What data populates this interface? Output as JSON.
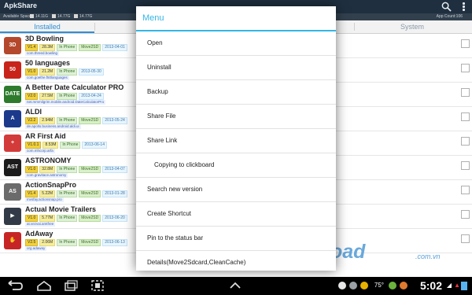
{
  "app": {
    "title": "ApkShare"
  },
  "store": {
    "label": "Available Space",
    "stats": [
      "14.11G",
      "14.77G",
      "14.77G"
    ],
    "count": "App Count:106"
  },
  "tabs": [
    {
      "label": "Installed"
    },
    {
      "label": ""
    },
    {
      "label": "System"
    }
  ],
  "apps": [
    {
      "name": "3D Bowling",
      "version": "V1.4",
      "size": "28.3M",
      "location": "In Phone",
      "move": "Move2SD",
      "date": "2013-04-01",
      "pkg": "com.threed.bowling",
      "icon_color": "#b4482c",
      "icon_text": "3D"
    },
    {
      "name": "50 languages",
      "version": "V1.0",
      "size": "21.2M",
      "location": "In Phone",
      "move": "",
      "date": "2013-05-30",
      "pkg": "com.goethe.f50languages",
      "icon_color": "#c8241a",
      "icon_text": "50"
    },
    {
      "name": "A Better Date Calculator PRO",
      "version": "V2.0",
      "size": "27.5M",
      "location": "In Phone",
      "move": "",
      "date": "2013-04-24",
      "pkg": "net.mmmilgrim.mobile.android.DateCalculatorPro",
      "icon_color": "#2e7b2d",
      "icon_text": "DATE"
    },
    {
      "name": "ALDI",
      "version": "V2.2",
      "size": "2.94M",
      "location": "In Phone",
      "move": "Move2SD",
      "date": "2013-05-24",
      "pkg": "de.apollo.business.android.aldi.ui",
      "icon_color": "#1b3a8c",
      "icon_text": "A"
    },
    {
      "name": "AR First Aid",
      "version": "V1.0.1",
      "size": "8.53M",
      "location": "In Phone",
      "move": "",
      "date": "2013-06-14",
      "pkg": "com.mhcorp.arfa",
      "icon_color": "#d33a3a",
      "icon_text": "+"
    },
    {
      "name": "ASTRONOMY",
      "version": "V1.0",
      "size": "32.8M",
      "location": "In Phone",
      "move": "Move2SD",
      "date": "2013-04-07",
      "pkg": "com.gravitace.astronomy",
      "icon_color": "#1c1c1c",
      "icon_text": "AST"
    },
    {
      "name": "ActionSnapPro",
      "version": "V1.4",
      "size": "5.22M",
      "location": "In Phone",
      "move": "Move2SD",
      "date": "2013-01-28",
      "pkg": "mvsfay.actionsnap.pro",
      "icon_color": "#6b6b6b",
      "icon_text": "AS"
    },
    {
      "name": "Actual Movie Trailers",
      "version": "V1.0",
      "size": "5.77M",
      "location": "In Phone",
      "move": "Move2SD",
      "date": "2013-06-20",
      "pkg": "at.vezvai.amtfree",
      "icon_color": "#333a47",
      "icon_text": "▶"
    },
    {
      "name": "AdAway",
      "version": "V2.5",
      "size": "2.06M",
      "location": "In Phone",
      "move": "Move2SD",
      "date": "2013-06-13",
      "pkg": "org.adaway",
      "icon_color": "#c72525",
      "icon_text": "✋"
    }
  ],
  "dialog": {
    "title": "Menu",
    "items": [
      {
        "label": "Open",
        "indent": false
      },
      {
        "label": "Uninstall",
        "indent": false
      },
      {
        "label": "Backup",
        "indent": false
      },
      {
        "label": "Share File",
        "indent": false
      },
      {
        "label": "Share Link",
        "indent": false
      },
      {
        "label": "Copying to clickboard",
        "indent": true
      },
      {
        "label": "Search new version",
        "indent": false
      },
      {
        "label": "Create Shortcut",
        "indent": false
      },
      {
        "label": "Pin to the status bar",
        "indent": false
      },
      {
        "label": "Details(Move2Sdcard,CleanCache)",
        "indent": false
      }
    ]
  },
  "watermark": {
    "text": "Download",
    "sub": ".com.vn"
  },
  "statusbar": {
    "time": "5:02",
    "temp": "75°"
  },
  "colors": {
    "accent": "#33b5e5",
    "appbar": "#1f2f3f",
    "version_tag": "#f3d23a"
  }
}
